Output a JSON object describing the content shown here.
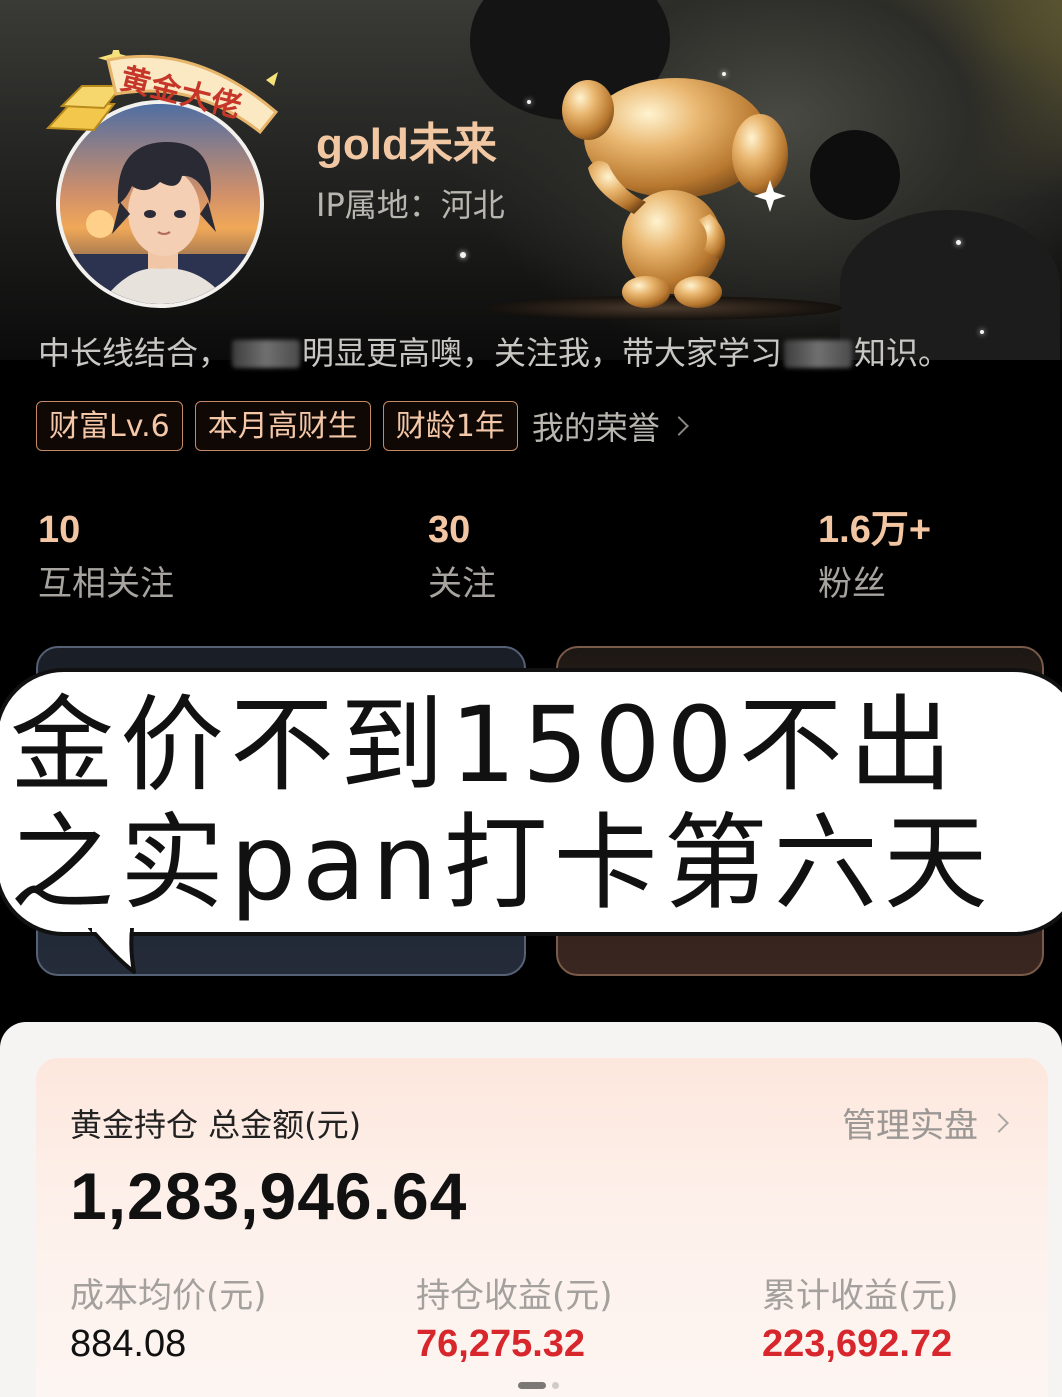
{
  "profile": {
    "badge_text": "黄金大佬",
    "user_name": "gold未来",
    "ip_location": "IP属地：河北",
    "bio_part1": "中长线结合，",
    "bio_part2": "明显更高噢，关注我，带大家学习",
    "bio_part3": "知识。"
  },
  "honors": {
    "tags": [
      "财富Lv.6",
      "本月高财生",
      "财龄1年"
    ],
    "link_label": "我的荣誉"
  },
  "stats": [
    {
      "value": "10",
      "label": "互相关注"
    },
    {
      "value": "30",
      "label": "关注"
    },
    {
      "value": "1.6万+",
      "label": "粉丝"
    }
  ],
  "overlay": {
    "line1": "金价不到1500不出",
    "line2": "之实pan打卡第六天"
  },
  "asset": {
    "title": "黄金持仓 总金额(元)",
    "manage_label": "管理实盘",
    "total": "1,283,946.64",
    "metrics": [
      {
        "label": "成本均价(元)",
        "value": "884.08",
        "tone": "black"
      },
      {
        "label": "持仓收益(元)",
        "value": "76,275.32",
        "tone": "red"
      },
      {
        "label": "累计收益(元)",
        "value": "223,692.72",
        "tone": "red"
      }
    ]
  },
  "colors": {
    "accent_gold": "#f1c8a3",
    "profit_red": "#d8262d",
    "tag_border": "#c48a67"
  },
  "icons": {
    "honor_chevron": "chevron-right-icon",
    "manage_chevron": "chevron-right-icon",
    "badge": "gold-bar-icon",
    "mascot": "gold-mascot-icon"
  }
}
